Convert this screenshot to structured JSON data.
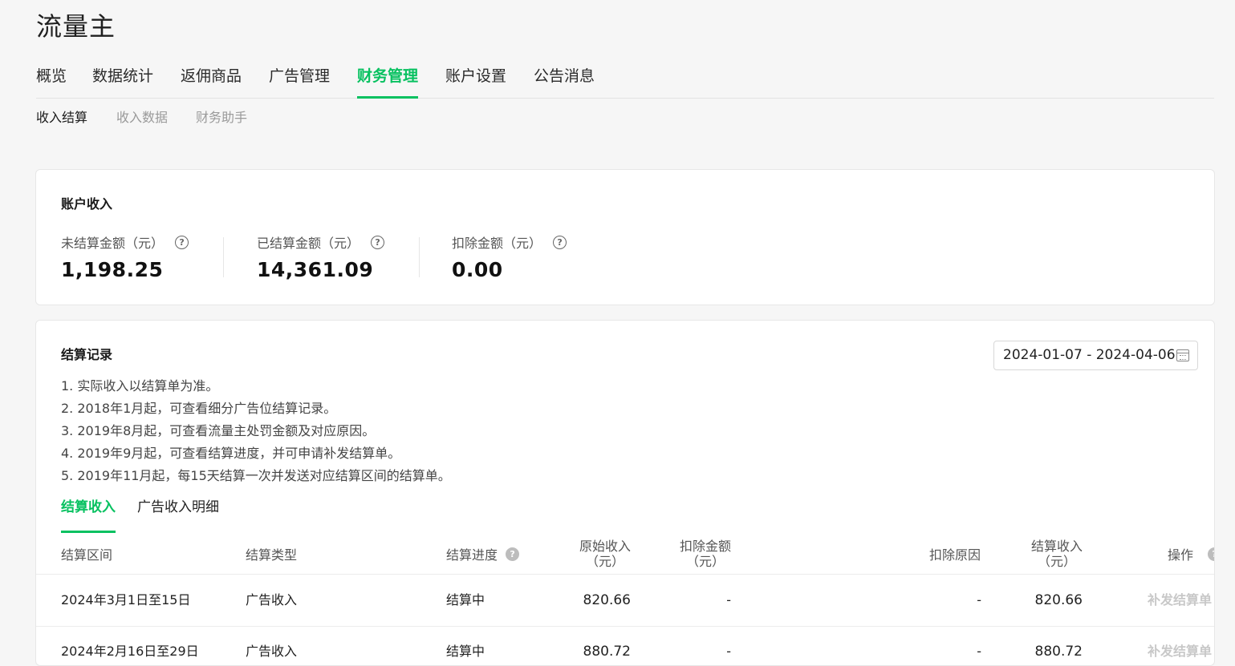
{
  "app": {
    "title": "流量主"
  },
  "main_nav": [
    {
      "label": "概览",
      "active": false
    },
    {
      "label": "数据统计",
      "active": false
    },
    {
      "label": "返佣商品",
      "active": false
    },
    {
      "label": "广告管理",
      "active": false
    },
    {
      "label": "财务管理",
      "active": true
    },
    {
      "label": "账户设置",
      "active": false
    },
    {
      "label": "公告消息",
      "active": false
    }
  ],
  "sub_nav": [
    {
      "label": "收入结算",
      "active": true
    },
    {
      "label": "收入数据",
      "active": false
    },
    {
      "label": "财务助手",
      "active": false
    }
  ],
  "income": {
    "title": "账户收入",
    "metrics": [
      {
        "label": "未结算金额（元）",
        "value": "1,198.25"
      },
      {
        "label": "已结算金额（元）",
        "value": "14,361.09"
      },
      {
        "label": "扣除金额（元）",
        "value": "0.00"
      }
    ]
  },
  "records": {
    "title": "结算记录",
    "date_range": "2024-01-07 - 2024-04-06",
    "notes": [
      "1. 实际收入以结算单为准。",
      "2. 2018年1月起，可查看细分广告位结算记录。",
      "3. 2019年8月起，可查看流量主处罚金额及对应原因。",
      "4. 2019年9月起，可查看结算进度，并可申请补发结算单。",
      "5. 2019年11月起，每15天结算一次并发送对应结算区间的结算单。"
    ],
    "tabs": [
      {
        "label": "结算收入",
        "active": true
      },
      {
        "label": "广告收入明细",
        "active": false
      }
    ],
    "columns": {
      "period": "结算区间",
      "type": "结算类型",
      "progress": "结算进度",
      "raw_income_1": "原始收入",
      "raw_income_2": "（元）",
      "deduct_1": "扣除金额",
      "deduct_2": "（元）",
      "reason": "扣除原因",
      "settled_1": "结算收入",
      "settled_2": "（元）",
      "action": "操作"
    },
    "help_glyph": "?",
    "rows": [
      {
        "period": "2024年3月1日至15日",
        "type": "广告收入",
        "progress": "结算中",
        "raw_income": "820.66",
        "deduct": "-",
        "reason": "-",
        "settled": "820.66",
        "action": "补发结算单"
      },
      {
        "period": "2024年2月16日至29日",
        "type": "广告收入",
        "progress": "结算中",
        "raw_income": "880.72",
        "deduct": "-",
        "reason": "-",
        "settled": "880.72",
        "action": "补发结算单"
      }
    ]
  }
}
